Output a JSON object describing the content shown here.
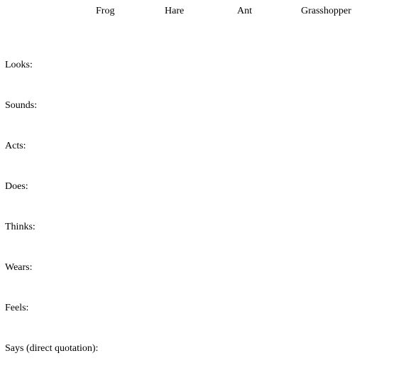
{
  "columns": [
    "Frog",
    "Hare",
    "Ant",
    "Grasshopper"
  ],
  "rows": [
    "Looks:",
    "Sounds:",
    "Acts:",
    "Does:",
    "Thinks:",
    "Wears:",
    "Feels:",
    "Says (direct quotation):"
  ]
}
